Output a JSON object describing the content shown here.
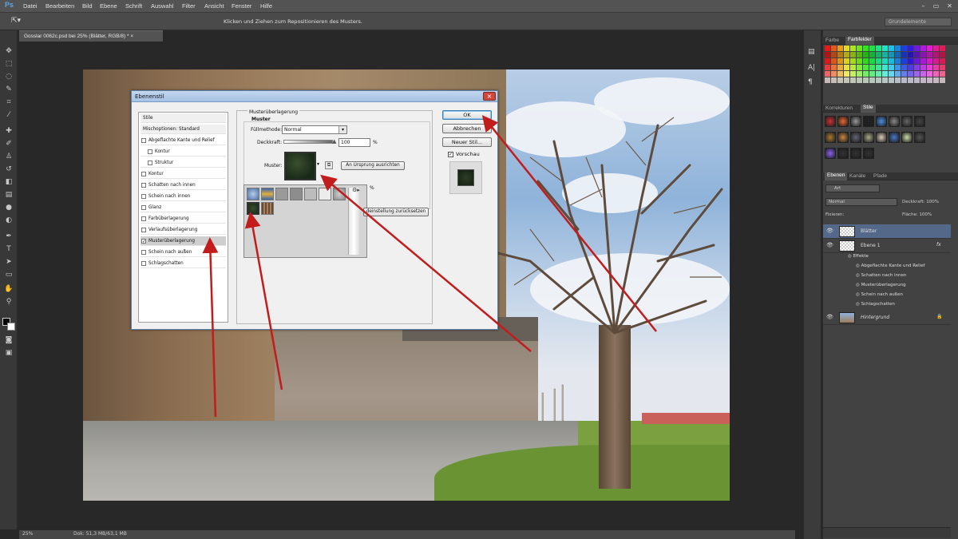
{
  "app": {
    "logo": "Ps"
  },
  "menu": [
    "Datei",
    "Bearbeiten",
    "Bild",
    "Ebene",
    "Schrift",
    "Auswahl",
    "Filter",
    "Ansicht",
    "Fenster",
    "Hilfe"
  ],
  "options_bar": {
    "hint": "Klicken und Ziehen zum Repositionieren des Musters.",
    "workspace": "Grundelemente"
  },
  "document": {
    "tab_title": "Gosslar 0062c.psd bei 25% (Blätter, RGB/8) *",
    "tab_close": "×"
  },
  "status": {
    "zoom": "25%",
    "doc_size": "Dok: 51,3 MB/63,1 MB"
  },
  "panels": {
    "swatch_tabs": [
      "Farbe",
      "Farbfelder"
    ],
    "style_tabs": [
      "Korrekturen",
      "Stile"
    ],
    "layer_tabs": [
      "Ebenen",
      "Kanäle",
      "Pfade"
    ],
    "kind_filter": "Art",
    "blend_mode": "Normal",
    "opacity_label": "Deckkraft: 100%",
    "lock_label": "Fixieren:",
    "fill_label": "Fläche: 100%",
    "layers": [
      {
        "name": "Blätter",
        "active": true
      },
      {
        "name": "Ebene 1",
        "active": false,
        "fx": "fx"
      },
      {
        "name": "Hintergrund",
        "active": false
      }
    ],
    "effects_label": "Effekte",
    "effects": [
      "Abgeflachte Kante und Relief",
      "Schatten nach innen",
      "Musterüberlagerung",
      "Schein nach außen",
      "Schlagschatten"
    ]
  },
  "dialog": {
    "title": "Ebenenstil",
    "close": "×",
    "styles_header": "Stile",
    "blend_options": "Mischoptionen: Standard",
    "items": [
      {
        "label": "Abgeflachte Kante und Relief",
        "checked": false,
        "sub": false
      },
      {
        "label": "Kontur",
        "checked": false,
        "sub": true
      },
      {
        "label": "Struktur",
        "checked": false,
        "sub": true
      },
      {
        "label": "Kontur",
        "checked": false,
        "sub": false
      },
      {
        "label": "Schatten nach innen",
        "checked": false,
        "sub": false
      },
      {
        "label": "Schein nach innen",
        "checked": false,
        "sub": false
      },
      {
        "label": "Glanz",
        "checked": false,
        "sub": false
      },
      {
        "label": "Farbüberlagerung",
        "checked": false,
        "sub": false
      },
      {
        "label": "Verlaufsüberlagerung",
        "checked": false,
        "sub": false
      },
      {
        "label": "Musterüberlagerung",
        "checked": true,
        "sub": false,
        "selected": true
      },
      {
        "label": "Schein nach außen",
        "checked": false,
        "sub": false
      },
      {
        "label": "Schlagschatten",
        "checked": false,
        "sub": false
      }
    ],
    "group_title": "Musterüberlagerung",
    "sub_title": "Muster",
    "fill_mode_label": "Füllmethode:",
    "fill_mode_value": "Normal",
    "opacity_label": "Deckkraft:",
    "opacity_value": "100",
    "percent": "%",
    "pattern_label": "Muster:",
    "snap_origin": "An Ursprung ausrichten",
    "reset_default": "deinstellung zurücksetzen",
    "ok": "OK",
    "cancel": "Abbrechen",
    "new_style": "Neuer Stil...",
    "preview": "Vorschau"
  }
}
